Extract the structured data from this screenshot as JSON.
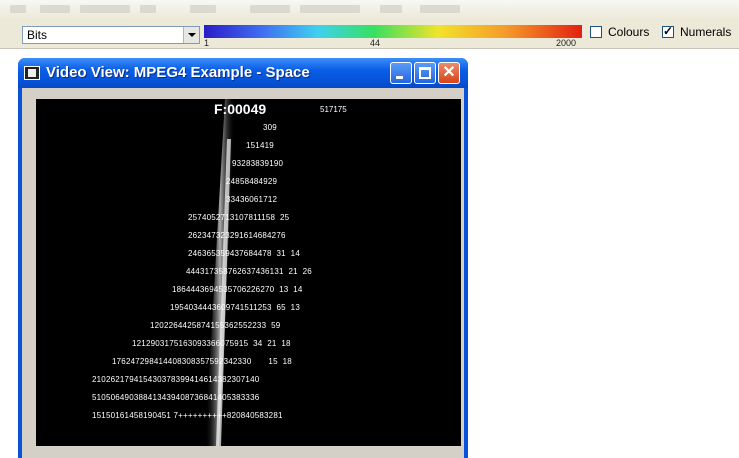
{
  "toolbar": {
    "metric_select": {
      "value": "Bits"
    },
    "color_scale": {
      "min_label": "1",
      "mid_label": "44",
      "max_label": "2000"
    },
    "colours_checkbox": {
      "label": "Colours",
      "checked": false
    },
    "numerals_checkbox": {
      "label": "Numerals",
      "checked": true
    }
  },
  "window": {
    "title": "Video View: MPEG4 Example - Space",
    "buttons": {
      "close": "✕"
    }
  },
  "video": {
    "frame_label": "F:00049",
    "frame_extra": "517175",
    "rows": [
      "309",
      "151419",
      "93283839190",
      "24858484929",
      "33436061712",
      "2574052713107811158  25",
      "262347323291614684276",
      "246365359437684478  31  14",
      "444317358762637436131  21  26",
      "1864443694535706226270  13  14",
      "1954034443609741511253  65  13",
      "1202264425874155362552233  59",
      "1212903175163093366075915  34  21  18",
      "176247298414408308357592342330       15  18",
      "210262179415430378399414614382307140",
      "510506490388413439408736841405383336",
      "15150161458190451 7++++++++++820840583281"
    ]
  }
}
